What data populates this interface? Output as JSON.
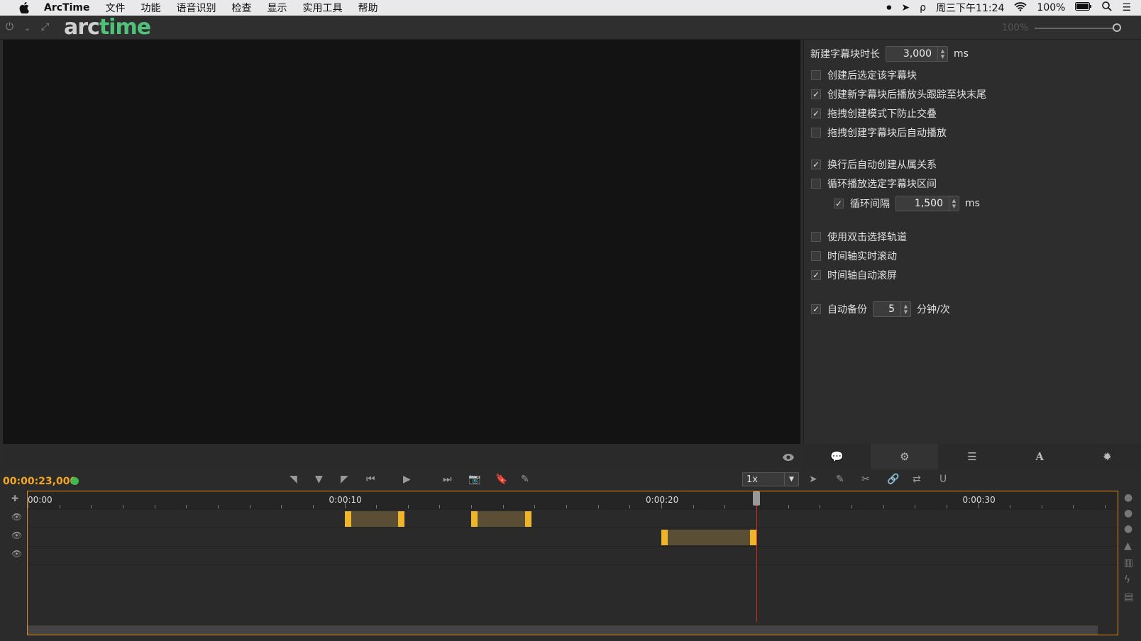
{
  "menubar": {
    "app": "ArcTime",
    "items": [
      "文件",
      "功能",
      "语音识别",
      "检查",
      "显示",
      "实用工具",
      "帮助"
    ],
    "battery": "100%",
    "clock": "周三下午11:24"
  },
  "toolbar": {
    "logo_a": "arc",
    "logo_b": "time",
    "zoom": "100%"
  },
  "settings": {
    "duration_label": "新建字幕块时长",
    "duration_value": "3,000",
    "duration_unit": "ms",
    "options": [
      {
        "label": "创建后选定该字幕块",
        "checked": false
      },
      {
        "label": "创建新字幕块后播放头跟踪至块末尾",
        "checked": true
      },
      {
        "label": "拖拽创建模式下防止交叠",
        "checked": true
      },
      {
        "label": "拖拽创建字幕块后自动播放",
        "checked": false
      },
      {
        "label": "换行后自动创建从属关系",
        "checked": true
      },
      {
        "label": "循环播放选定字幕块区间",
        "checked": false
      },
      {
        "label": "使用双击选择轨道",
        "checked": false
      },
      {
        "label": "时间轴实时滚动",
        "checked": false
      },
      {
        "label": "时间轴自动滚屏",
        "checked": true
      }
    ],
    "loop_label": "循环间隔",
    "loop_checked": true,
    "loop_value": "1,500",
    "loop_unit": "ms",
    "backup_label": "自动备份",
    "backup_checked": true,
    "backup_value": "5",
    "backup_unit": "分钟/次"
  },
  "transport": {
    "timecode": "00:00:23,000",
    "speed": "1x"
  },
  "timeline": {
    "duration_seconds": 34.4,
    "playhead_seconds": 23,
    "ruler_labels": [
      {
        "text": "00:00",
        "t": 0
      },
      {
        "text": "0:00:10",
        "t": 10
      },
      {
        "text": "0:00:20",
        "t": 20
      },
      {
        "text": "0:00:30",
        "t": 30
      }
    ],
    "tracks": [
      {
        "blocks": [
          {
            "start": 10.0,
            "end": 11.9
          },
          {
            "start": 14.0,
            "end": 15.9
          }
        ]
      },
      {
        "blocks": [
          {
            "start": 20.0,
            "end": 23.0
          }
        ]
      },
      {
        "blocks": []
      }
    ]
  },
  "colors": {
    "accent_orange": "#f5a623",
    "logo_green": "#4fc27a",
    "playhead_red": "#d0321e",
    "block_fill": "#5a4f35",
    "block_edge": "#f0b429"
  }
}
